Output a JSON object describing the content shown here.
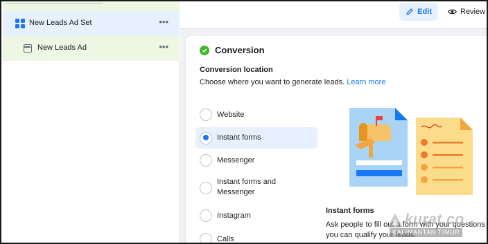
{
  "sidebar": {
    "adset_label": "New Leads Ad Set",
    "ad_label": "New Leads Ad",
    "more_glyph": "•••"
  },
  "toolbar": {
    "edit_label": "Edit",
    "review_label": "Review",
    "edit_icon": "pencil-icon",
    "review_icon": "eye-icon"
  },
  "conversion": {
    "title": "Conversion",
    "location_title": "Conversion location",
    "location_sub": "Choose where you want to generate leads.",
    "learn_more": "Learn more",
    "options": [
      {
        "label": "Website",
        "selected": false
      },
      {
        "label": "Instant forms",
        "selected": true
      },
      {
        "label": "Messenger",
        "selected": false
      },
      {
        "label": "Instant forms and Messenger",
        "selected": false
      },
      {
        "label": "Instagram",
        "selected": false
      },
      {
        "label": "Calls",
        "selected": false
      }
    ],
    "description_title": "Instant forms",
    "description_text": "Ask people to fill out a form with your questions so you can qualify your leads."
  },
  "watermark": {
    "brand": "kurat.co",
    "region": "KALIMANTAN TIMUR"
  },
  "colors": {
    "accent": "#1877f2",
    "selected_bg": "#e7f0fd",
    "ad_row_bg": "#eef6e4",
    "success": "#42b72a"
  }
}
